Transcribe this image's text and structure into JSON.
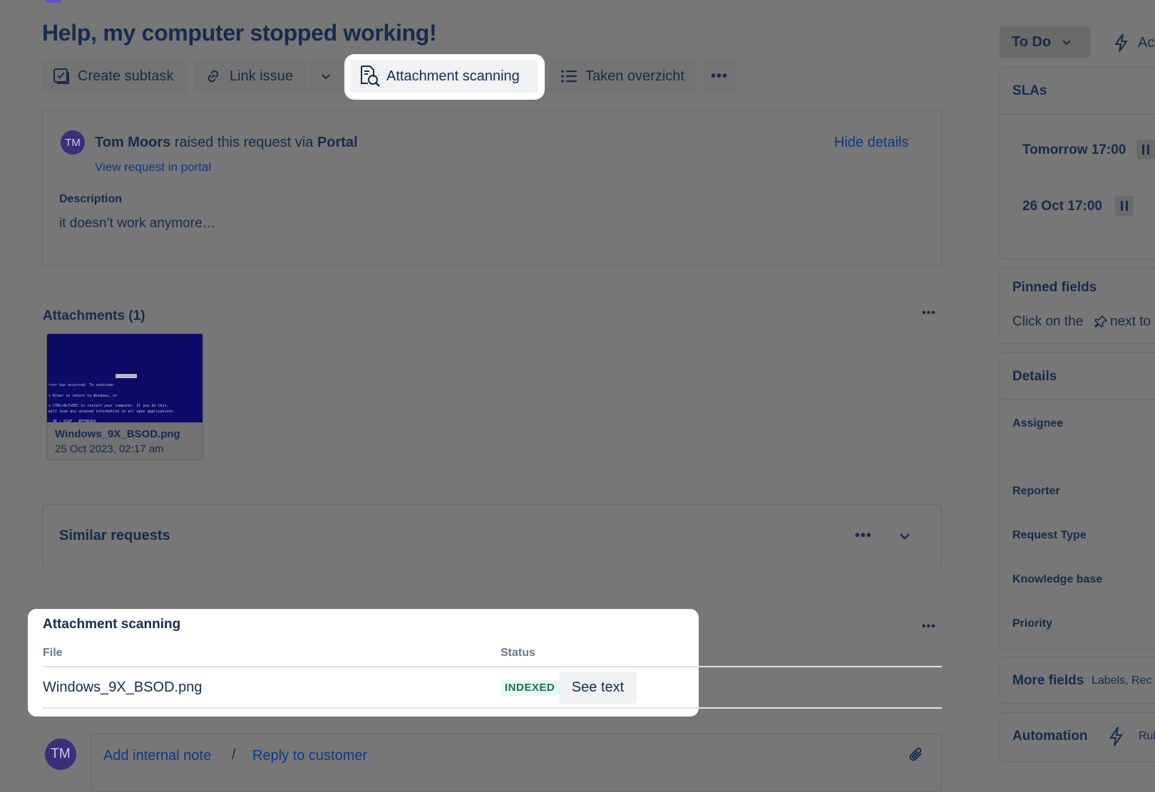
{
  "issue": {
    "title": "Help, my computer stopped working!"
  },
  "toolbar": {
    "create_subtask": "Create subtask",
    "link_issue": "Link issue",
    "attachment_scanning": "Attachment scanning",
    "taken_overzicht": "Taken overzicht"
  },
  "request": {
    "avatar_initials": "TM",
    "reporter_name": "Tom Moors",
    "raised_text": " raised this request via ",
    "channel": "Portal",
    "view_in_portal": "View request in portal",
    "hide_details": "Hide details",
    "description_label": "Description",
    "description": "it doesn’t work anymore…"
  },
  "attachments": {
    "title": "Attachments (1)",
    "items": [
      {
        "name": "Windows_9X_BSOD.png",
        "date": "25 Oct 2023, 02:17 am"
      }
    ]
  },
  "similar_requests": {
    "title": "Similar requests"
  },
  "attachment_scanning_panel": {
    "title": "Attachment scanning",
    "columns": [
      "File",
      "Status"
    ],
    "rows": [
      {
        "file": "Windows_9X_BSOD.png",
        "status": "INDEXED",
        "action": "See text"
      }
    ]
  },
  "composer": {
    "avatar_initials": "TM",
    "add_internal_note": "Add internal note",
    "separator": "/",
    "reply_to_customer": "Reply to customer"
  },
  "right_panel": {
    "status": "To Do",
    "actions_partial": "Ac",
    "slas_title": "SLAs",
    "sla_times": [
      "Tomorrow 17:00",
      "26 Oct 17:00"
    ],
    "pinned_title": "Pinned fields",
    "pinned_hint": "Click on the",
    "pinned_hint_tail": "next to",
    "details_title": "Details",
    "fields": [
      "Assignee",
      "Reporter",
      "Request Type",
      "Knowledge base",
      "Priority"
    ],
    "more_fields": "More fields",
    "more_fields_sub": "Labels, Rec",
    "automation": "Automation",
    "automation_partial": "Rul"
  },
  "colors": {
    "overlay": "#777777",
    "link": "#0c3a86",
    "text": "#172b4d",
    "indexed_bg": "#e3fcef",
    "indexed_text": "#216e4e"
  }
}
